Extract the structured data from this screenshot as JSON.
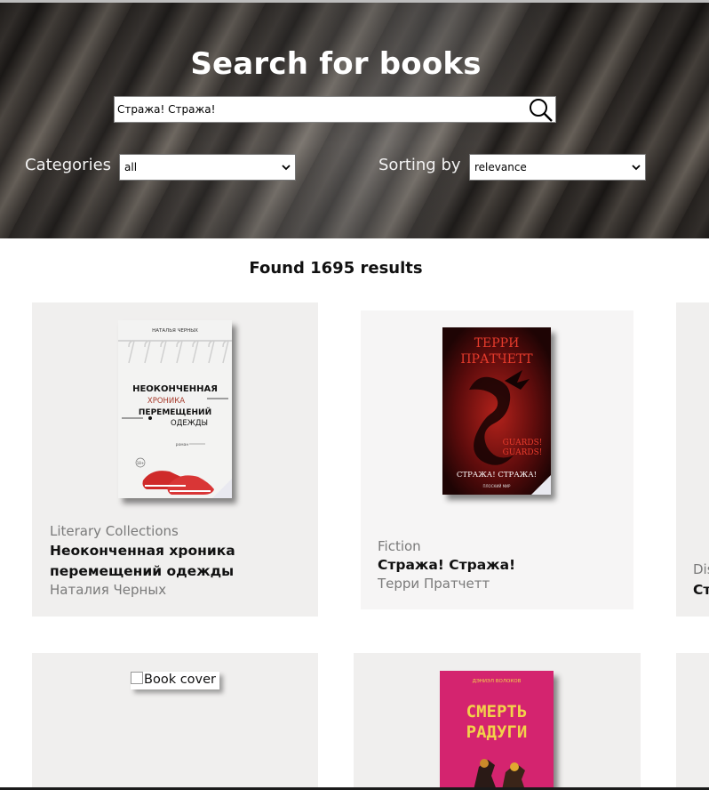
{
  "hero": {
    "title": "Search for books",
    "search_value": "Стража! Стража!",
    "categories_label": "Categories",
    "categories_value": "all",
    "sorting_label": "Sorting by",
    "sorting_value": "relevance"
  },
  "results": {
    "text": "Found 1695 results"
  },
  "books": [
    {
      "category": "Literary Collections",
      "title": "Неоконченная хроника перемещений одежды",
      "author": "Наталия Черных",
      "cover": {
        "author_line": "НАТАЛЬЯ ЧЕРНЫХ",
        "title_lines": [
          "НЕОКОНЧЕННАЯ",
          "ХРОНИКА",
          "ПЕРЕМЕЩЕНИЙ",
          "ОДЕЖДЫ"
        ],
        "genre": "роман",
        "age": "18+"
      }
    },
    {
      "category": "Fiction",
      "title": "Стража! Стража!",
      "author": "Терри Пратчетт",
      "cover": {
        "author_lines": [
          "ТЕРРИ",
          "ПРАТЧЕТТ"
        ],
        "orig_lines": [
          "GUARDS!",
          "GUARDS!"
        ],
        "title_line": "СТРАЖА! СТРАЖА!",
        "series": "ПЛОСКИЙ МИР",
        "colors": {
          "bg": "#2a0708",
          "accent": "#c2271b"
        }
      }
    },
    {
      "category": "Dis",
      "title": "Ст"
    },
    {
      "alt": "Book cover"
    },
    {
      "cover": {
        "author_line": "ДЭНИЭЛ ВОЛОКОВ",
        "title_lines": [
          "СМЕРТЬ",
          "РАДУГИ"
        ],
        "colors": {
          "bg": "#d4246f",
          "text": "#f2d24a"
        }
      }
    }
  ]
}
